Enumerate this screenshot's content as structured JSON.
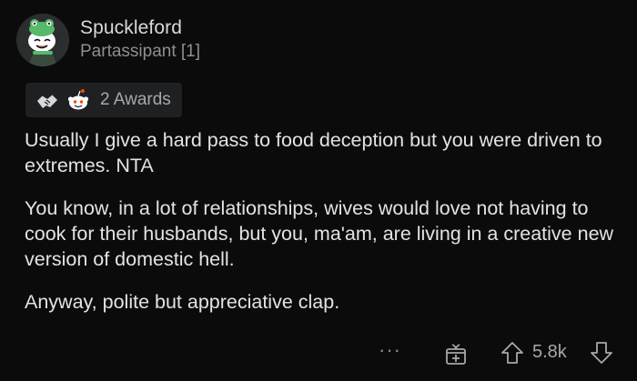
{
  "comment": {
    "username": "Spuckleford",
    "flair": "Partassipant [1]",
    "awards_label": "2 Awards",
    "paragraphs": [
      "Usually I give a hard pass to food deception but you were driven to extremes. NTA",
      "You know, in a lot of relationships, wives would love not having to cook for their husbands, but you, ma'am, are living in a creative new version of domestic hell.",
      "Anyway, polite but appreciative clap."
    ],
    "more_label": "···",
    "score": "5.8k"
  },
  "icons": {
    "avatar": "frog-avatar",
    "award_1": "handshake-award-icon",
    "award_2": "snoo-award-icon",
    "gift": "gift-icon",
    "upvote": "upvote-arrow-icon",
    "downvote": "downvote-arrow-icon"
  },
  "colors": {
    "background": "#0b0b0b",
    "text": "#e1e3e5",
    "muted": "#8c8f93",
    "award_pill": "#1f2022",
    "avatar_green": "#57b96a"
  }
}
